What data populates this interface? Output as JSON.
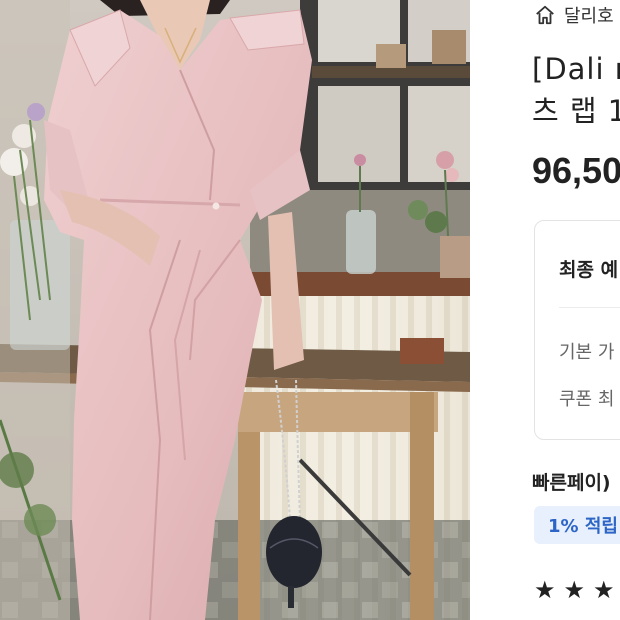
{
  "product_image": {
    "alt": ""
  },
  "breadcrumb": {
    "home_icon": "home-icon",
    "shop_name": "달리호"
  },
  "product": {
    "title_line1": "[Dali m",
    "title_line2": "츠 랩 1",
    "price": "96,50"
  },
  "price_card": {
    "final_label": "최종 예",
    "base_label": "기본 가",
    "coupon_label": "쿠폰 최"
  },
  "fastpay": {
    "label": "빠른페이)",
    "badge": "1% 적립"
  },
  "rating": {
    "star_glyph": "★",
    "visible_stars": 3
  },
  "colors": {
    "badge_bg": "#e7f0fc",
    "badge_text": "#2d65c6",
    "dress": "#e8c1c3"
  }
}
